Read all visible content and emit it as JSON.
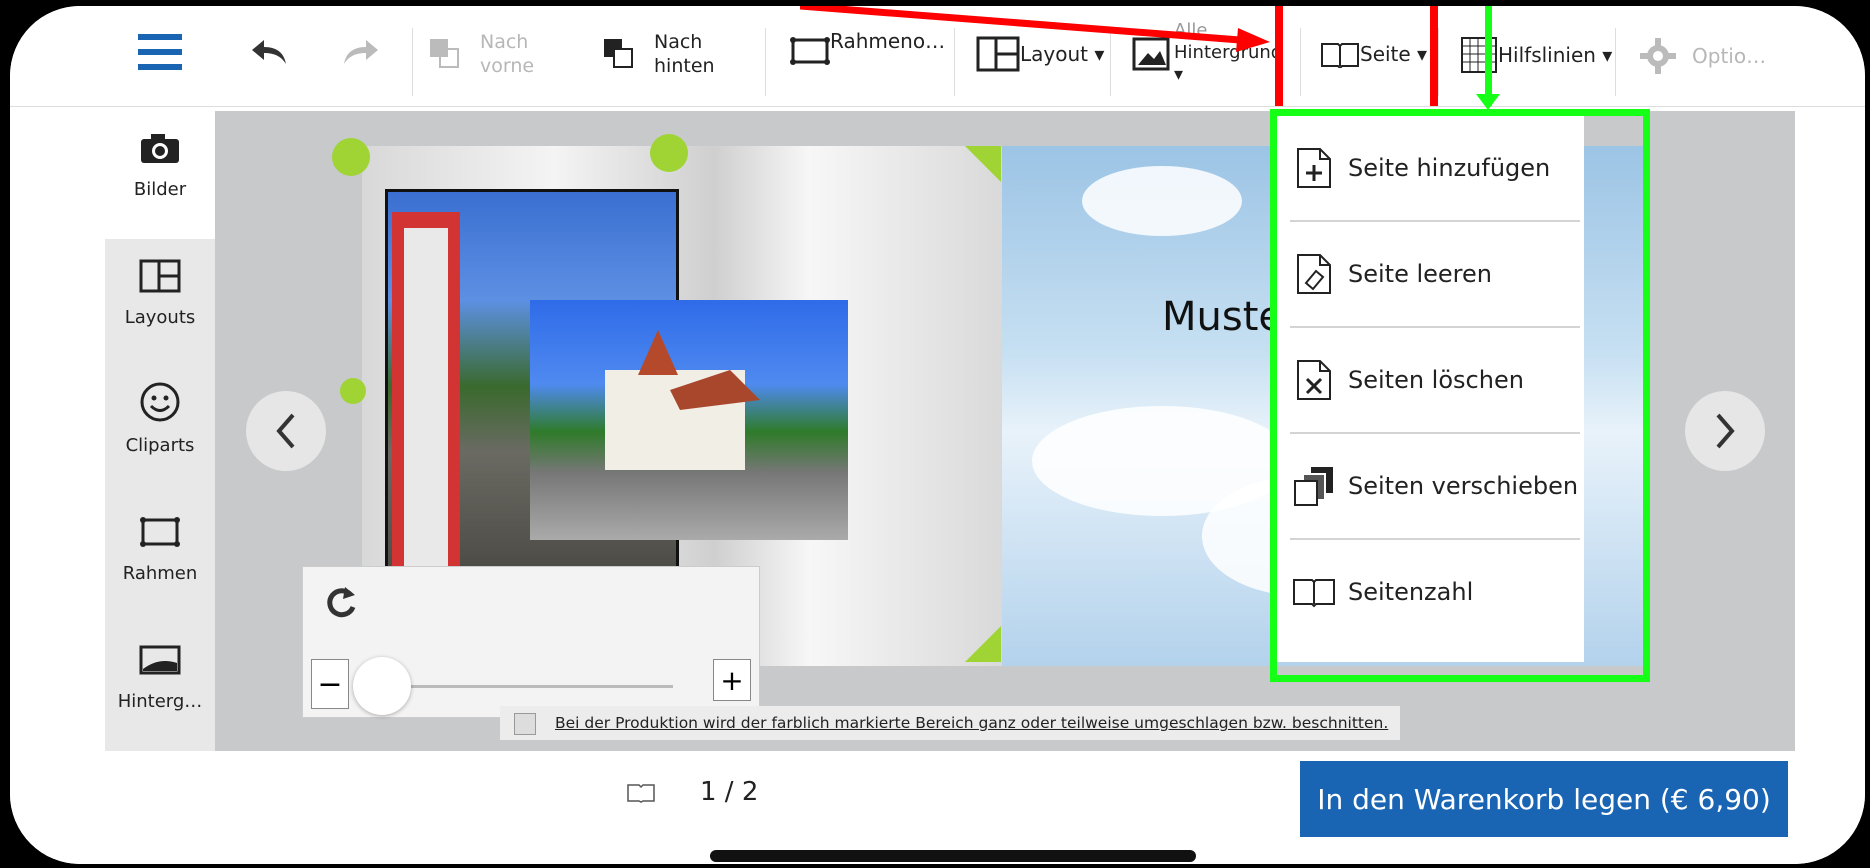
{
  "toolbar": {
    "nach_vorne_1": "Nach",
    "nach_vorne_2": "vorne",
    "nach_hinten_1": "Nach",
    "nach_hinten_2": "hinten",
    "rahmen": "Rahmeno…",
    "layout": "Layout ▾",
    "hintergrund_1": "Alle",
    "hintergrund_2": "Hintergrund",
    "seite": "Seite ▾",
    "hilfslinien": "Hilfslinien ▾",
    "optionen": "Optio…"
  },
  "sidebar": {
    "items": [
      {
        "label": "Bilder"
      },
      {
        "label": "Layouts"
      },
      {
        "label": "Cliparts"
      },
      {
        "label": "Rahmen"
      },
      {
        "label": "Hinterg…"
      }
    ]
  },
  "canvas": {
    "right_page_text": "Muste"
  },
  "seite_menu": {
    "items": [
      {
        "label": "Seite hinzufügen",
        "icon": "page-add-icon"
      },
      {
        "label": "Seite leeren",
        "icon": "page-clear-icon"
      },
      {
        "label": "Seiten löschen",
        "icon": "page-delete-icon"
      },
      {
        "label": "Seiten verschieben",
        "icon": "pages-move-icon"
      },
      {
        "label": "Seitenzahl",
        "icon": "book-icon"
      }
    ]
  },
  "notice": "Bei der Produktion wird der farblich markierte Bereich ganz oder teilweise umgeschlagen bzw. beschnitten.",
  "pager": {
    "value": "1 / 2"
  },
  "cart_label": "In den Warenkorb legen (€ 6,90)",
  "colors": {
    "accent_blue": "#1a64b4",
    "highlight_green": "#16ff16",
    "annotation_red": "#ff0000",
    "handle_green": "#9fd434"
  }
}
